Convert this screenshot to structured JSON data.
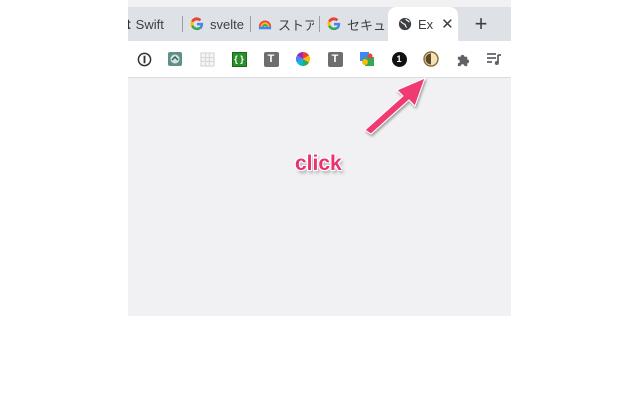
{
  "tabs": [
    {
      "title": "Swift",
      "icon": "ars-icon"
    },
    {
      "title": "svelte",
      "icon": "google-icon"
    },
    {
      "title": "ストア",
      "icon": "webstore-icon"
    },
    {
      "title": "セキュ",
      "icon": "google-icon"
    },
    {
      "title": "Ex",
      "icon": "globe-icon",
      "active": true
    }
  ],
  "new_tab": "+",
  "close": "✕",
  "toolbar_extensions": [
    {
      "name": "1password-icon"
    },
    {
      "name": "ext-globe-icon"
    },
    {
      "name": "ext-grid-icon"
    },
    {
      "name": "json-icon",
      "label": "{ }"
    },
    {
      "name": "t-icon",
      "label": "T"
    },
    {
      "name": "color-wheel-icon"
    },
    {
      "name": "t-icon",
      "label": "T"
    },
    {
      "name": "google-tone-icon"
    },
    {
      "name": "one-icon",
      "label": "1"
    },
    {
      "name": "dark-mode-icon"
    },
    {
      "name": "puzzle-icon"
    },
    {
      "name": "media-queue-icon"
    }
  ],
  "annotation": {
    "text": "click",
    "color": "#e8336e"
  }
}
